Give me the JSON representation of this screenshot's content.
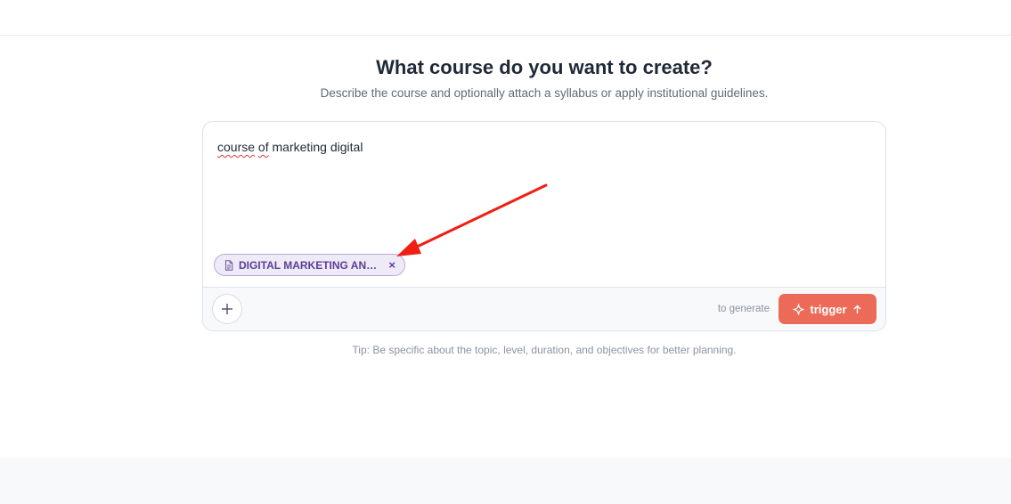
{
  "header": {
    "title": "What course do you want to create?",
    "subtitle": "Describe the course and optionally attach a syllabus or apply institutional guidelines."
  },
  "composer": {
    "prompt_words": [
      "course",
      "of",
      "marketing digital"
    ],
    "attachment": {
      "label": "DIGITAL MARKETING AN…",
      "icon": "document-icon",
      "close_label": "×"
    },
    "add_icon": "plus-icon",
    "hint": "to generate",
    "submit_label": "trigger",
    "submit_icon": "sparkle-icon",
    "submit_trailing_icon": "arrow-up-icon"
  },
  "tip": "Tip: Be specific about the topic, level, duration, and objectives for better planning.",
  "colors": {
    "accent": "#eb6b58",
    "chip_text": "#5b3e96",
    "chip_bg": "#efeaf7",
    "annotation": "#f01e14"
  }
}
